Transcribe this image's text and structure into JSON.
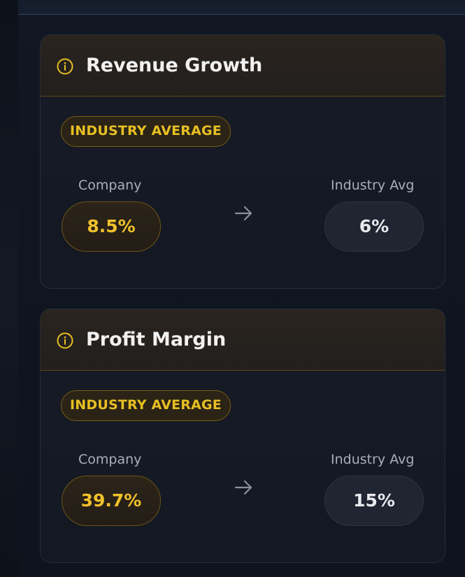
{
  "cards": [
    {
      "title": "Revenue Growth",
      "badge": "INDUSTRY AVERAGE",
      "company_label": "Company",
      "company_value": "8.5%",
      "industry_label": "Industry Avg",
      "industry_value": "6%"
    },
    {
      "title": "Profit Margin",
      "badge": "INDUSTRY AVERAGE",
      "company_label": "Company",
      "company_value": "39.7%",
      "industry_label": "Industry Avg",
      "industry_value": "15%"
    }
  ],
  "icons": {
    "header": "info-icon",
    "comparison": "arrow-right-icon"
  },
  "colors": {
    "accent_gold": "#e7bf23",
    "background": "#0e131d",
    "card_header": "#2a241f"
  }
}
